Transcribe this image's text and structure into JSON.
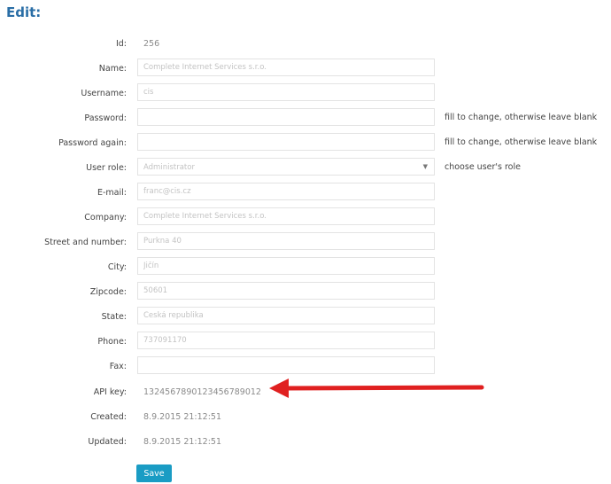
{
  "page": {
    "title": "Edit:"
  },
  "fields": {
    "id": {
      "label": "Id:",
      "value": "256"
    },
    "name": {
      "label": "Name:",
      "value": "Complete Internet Services s.r.o."
    },
    "username": {
      "label": "Username:",
      "value": "cis"
    },
    "password": {
      "label": "Password:",
      "value": "",
      "hint": "fill to change, otherwise leave blank"
    },
    "password_again": {
      "label": "Password again:",
      "value": "",
      "hint": "fill to change, otherwise leave blank"
    },
    "user_role": {
      "label": "User role:",
      "value": "Administrator",
      "hint": "choose user's role"
    },
    "email": {
      "label": "E-mail:",
      "value": "franc@cis.cz"
    },
    "company": {
      "label": "Company:",
      "value": "Complete Internet Services s.r.o."
    },
    "street": {
      "label": "Street and number:",
      "value": "Purkna 40"
    },
    "city": {
      "label": "City:",
      "value": "Jičín"
    },
    "zipcode": {
      "label": "Zipcode:",
      "value": "50601"
    },
    "state": {
      "label": "State:",
      "value": "Česká republika"
    },
    "phone": {
      "label": "Phone:",
      "value": "737091170"
    },
    "fax": {
      "label": "Fax:",
      "value": ""
    },
    "api_key": {
      "label": "API key:",
      "value": "1324567890123456789012"
    },
    "created": {
      "label": "Created:",
      "value": "8.9.2015 21:12:51"
    },
    "updated": {
      "label": "Updated:",
      "value": "8.9.2015 21:12:51"
    }
  },
  "actions": {
    "save_label": "Save"
  },
  "colors": {
    "title": "#2a6ea6",
    "save_button": "#1a9cc4",
    "annotation_arrow": "#e02020"
  }
}
